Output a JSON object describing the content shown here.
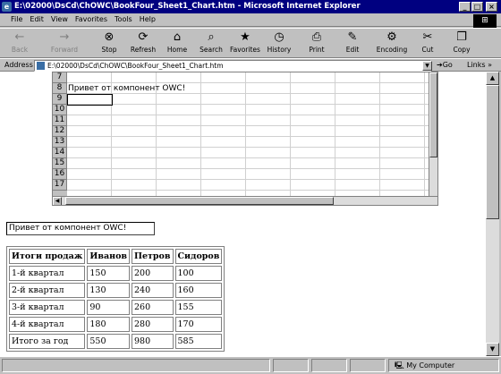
{
  "window": {
    "title": "E:\\02000\\DsCd\\ChOWC\\BookFour_Sheet1_Chart.htm - Microsoft Internet Explorer",
    "controls": {
      "minimize": "_",
      "maximize": "□",
      "close": "×"
    }
  },
  "menu": [
    "File",
    "Edit",
    "View",
    "Favorites",
    "Tools",
    "Help"
  ],
  "toolbar": [
    {
      "label": "Back",
      "icon": "←",
      "enabled": false
    },
    {
      "label": "Forward",
      "icon": "→",
      "enabled": false
    },
    {
      "label": "Stop",
      "icon": "⊗",
      "enabled": true
    },
    {
      "label": "Refresh",
      "icon": "⟳",
      "enabled": true
    },
    {
      "label": "Home",
      "icon": "⌂",
      "enabled": true
    },
    {
      "label": "Search",
      "icon": "⌕",
      "enabled": true
    },
    {
      "label": "Favorites",
      "icon": "★",
      "enabled": true
    },
    {
      "label": "History",
      "icon": "◷",
      "enabled": true
    },
    {
      "label": "Print",
      "icon": "⎙",
      "enabled": true
    },
    {
      "label": "Edit",
      "icon": "✎",
      "enabled": true
    },
    {
      "label": "Encoding",
      "icon": "⚙",
      "enabled": true
    },
    {
      "label": "Cut",
      "icon": "✂",
      "enabled": true
    },
    {
      "label": "Copy",
      "icon": "❐",
      "enabled": true
    }
  ],
  "address": {
    "label": "Address",
    "value": "E:\\02000\\DsCd\\ChOWC\\BookFour_Sheet1_Chart.htm",
    "go": "Go",
    "links": "Links »"
  },
  "spreadsheet": {
    "rows": [
      "7",
      "8",
      "9",
      "10",
      "11",
      "12",
      "13",
      "14",
      "15",
      "16",
      "17"
    ],
    "cell_a8": "Привет от компонент OWC!"
  },
  "textbox_value": "Привет от компонент OWC!",
  "sales_table": {
    "headers": [
      "Итоги продаж",
      "Иванов",
      "Петров",
      "Сидоров"
    ],
    "rows": [
      [
        "1-й квартал",
        "150",
        "200",
        "100"
      ],
      [
        "2-й квартал",
        "130",
        "240",
        "160"
      ],
      [
        "3-й квартал",
        "90",
        "260",
        "155"
      ],
      [
        "4-й квартал",
        "180",
        "280",
        "170"
      ],
      [
        "Итого за год",
        "550",
        "980",
        "585"
      ]
    ]
  },
  "status": {
    "zone": "My Computer"
  }
}
